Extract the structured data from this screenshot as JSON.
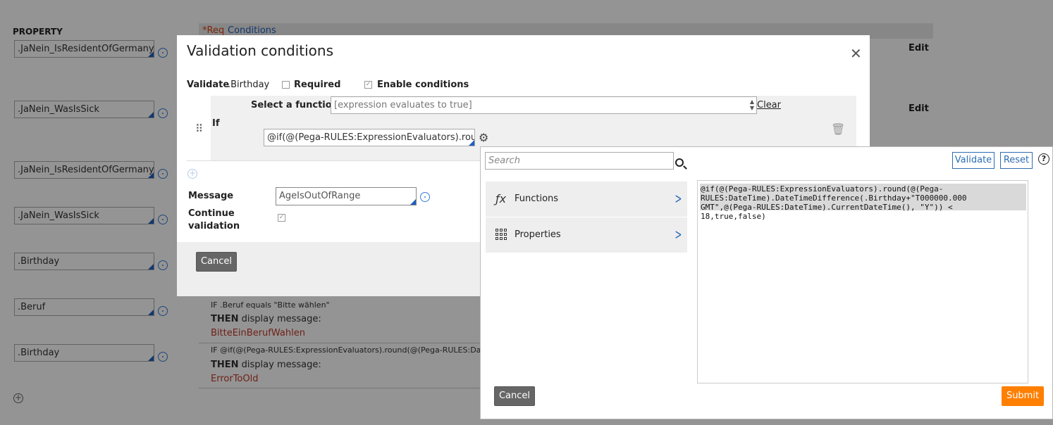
{
  "background": {
    "property_header": "PROPERTY",
    "req_label": "*Req",
    "conditions_label": "Conditions",
    "edit_label": "Edit",
    "properties": [
      ".JaNein_IsResidentOfGermany",
      ".JaNein_WasIsSick",
      ".JaNein_IsResidentOfGermany",
      ".JaNein_WasIsSick",
      ".Birthday",
      ".Beruf",
      ".Birthday"
    ],
    "rules": [
      {
        "if_text": "IF .Beruf equals \"Bitte wählen\"",
        "then_label": "THEN",
        "then_text": " display message:",
        "message": "BitteEinBerufWahlen"
      },
      {
        "if_text": "IF @if(@(Pega-RULES:ExpressionEvaluators).round(@(Pega-RULES:DateTim",
        "then_label": "THEN",
        "then_text": " display message:",
        "message": "ErrorToOld"
      }
    ]
  },
  "dialog": {
    "title": "Validation conditions",
    "validate_label": "Validate",
    "validate_value": ".Birthday",
    "required_label": "Required",
    "required_checked": false,
    "enable_conditions_label": "Enable conditions",
    "enable_conditions_checked": true,
    "if_label": "If",
    "select_function_label": "Select a function",
    "select_function_value": "[expression evaluates to true]",
    "clear_label": "Clear",
    "expression_value": "@if(@(Pega-RULES:ExpressionEvaluators).round(@",
    "message_label": "Message",
    "message_value": "AgeIsOutOfRange",
    "continue_validation_label": "Continue validation",
    "continue_validation_checked": true,
    "cancel_label": "Cancel"
  },
  "builder": {
    "search_placeholder": "Search",
    "validate_label": "Validate",
    "reset_label": "Reset",
    "help_label": "?",
    "nav": [
      {
        "label": "Functions",
        "icon": "function-icon"
      },
      {
        "label": "Properties",
        "icon": "grid-icon"
      }
    ],
    "code_lines": [
      "@if(@(Pega-RULES:ExpressionEvaluators).round(@(Pega-",
      "RULES:DateTime).DateTimeDifference(.Birthday+\"T000000.000",
      "GMT\",@(Pega-RULES:DateTime).CurrentDateTime(), \"Y\")) <",
      "18,true,false)"
    ],
    "cancel_label": "Cancel",
    "submit_label": "Submit"
  },
  "colors": {
    "accent": "#2e6db4",
    "submit": "#ff7f00",
    "error_text": "#c0392b",
    "overlay": "rgba(0,0,0,0.42)"
  }
}
